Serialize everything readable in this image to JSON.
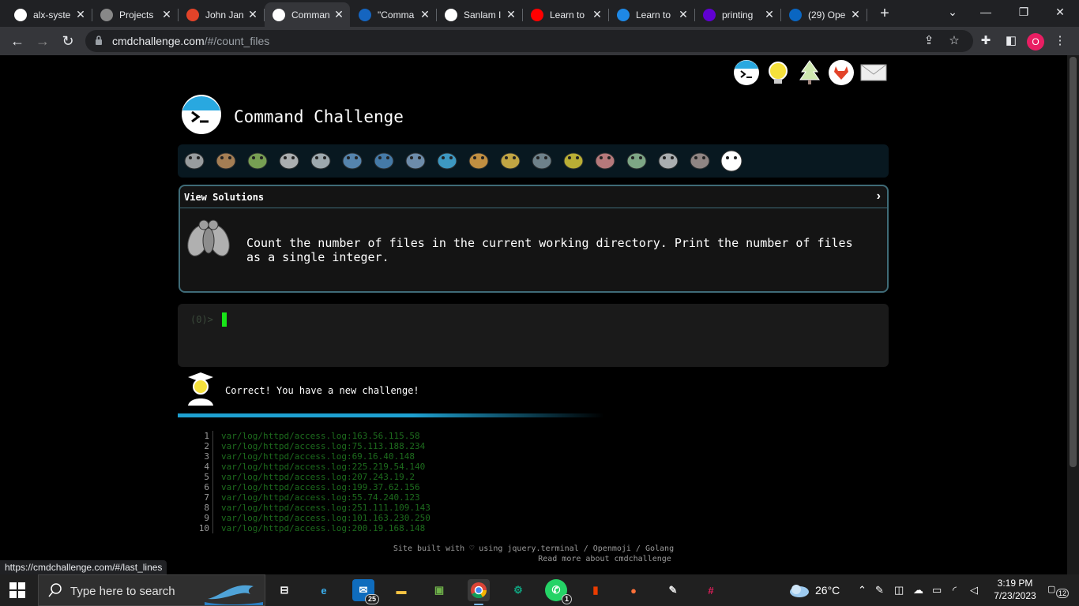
{
  "browser": {
    "tabs": [
      {
        "title": "alx-syste",
        "favicon": "github-icon",
        "color": "#ffffff"
      },
      {
        "title": "Projects",
        "favicon": "alx-icon",
        "color": "#888888"
      },
      {
        "title": "John Jan",
        "favicon": "gitlab-icon",
        "color": "#e24329"
      },
      {
        "title": "Comman",
        "favicon": "terminal-icon",
        "color": "#ffffff",
        "active": true
      },
      {
        "title": "\"Comma",
        "favicon": "warn-icon",
        "color": "#1565c0"
      },
      {
        "title": "Sanlam I",
        "favicon": "globe-icon",
        "color": "#ffffff"
      },
      {
        "title": "Learn to",
        "favicon": "youtube-icon",
        "color": "#ff0000"
      },
      {
        "title": "Learn to",
        "favicon": "globe-icon",
        "color": "#1e88e5"
      },
      {
        "title": "printing",
        "favicon": "yahoo-icon",
        "color": "#6001d2"
      },
      {
        "title": "(29) Ope",
        "favicon": "linkedin-icon",
        "color": "#0a66c2"
      }
    ],
    "new_tab": "+",
    "window": {
      "dropdown": "⌄",
      "minimize": "—",
      "maximize": "❐",
      "close": "✕"
    },
    "url": {
      "host": "cmdchallenge.com",
      "path": "/#/count_files"
    },
    "profile_initial": "O",
    "status_url": "https://cmdchallenge.com/#/last_lines"
  },
  "page": {
    "title": "Command Challenge",
    "panel_label": "View Solutions",
    "chevron": "›",
    "task": "Count the number of files in the current working directory. Print the number of files as a single integer.",
    "prompt": "(0)>",
    "success_message": "Correct! You have a new challenge!",
    "progress_fraction": 0.55,
    "output": [
      {
        "n": "1",
        "text": "var/log/httpd/access.log:163.56.115.58"
      },
      {
        "n": "2",
        "text": "var/log/httpd/access.log:75.113.188.234"
      },
      {
        "n": "3",
        "text": "var/log/httpd/access.log:69.16.40.148"
      },
      {
        "n": "4",
        "text": "var/log/httpd/access.log:225.219.54.140"
      },
      {
        "n": "5",
        "text": "var/log/httpd/access.log:207.243.19.2"
      },
      {
        "n": "6",
        "text": "var/log/httpd/access.log:199.37.62.156"
      },
      {
        "n": "7",
        "text": "var/log/httpd/access.log:55.74.240.123"
      },
      {
        "n": "8",
        "text": "var/log/httpd/access.log:251.111.109.143"
      },
      {
        "n": "9",
        "text": "var/log/httpd/access.log:101.163.230.250"
      },
      {
        "n": "10",
        "text": "var/log/httpd/access.log:200.19.168.148"
      }
    ],
    "footer_line1": "Site built with ♡ using jquery.terminal / Openmoji / Golang",
    "footer_line2": "Read more about cmdchallenge",
    "animals": [
      "snail-icon",
      "butterfly-icon",
      "caterpillar-icon",
      "ant-icon",
      "microbe-icon",
      "whale-icon",
      "dolphin-icon",
      "shark-icon",
      "fish-icon",
      "tropical-fish-icon",
      "blowfish-icon",
      "wolf-icon",
      "bee-icon",
      "ladybug-icon",
      "cricket-icon",
      "spider-icon",
      "scorpion-icon",
      "fly-icon"
    ]
  },
  "taskbar": {
    "search_placeholder": "Type here to search",
    "mail_badge": "25",
    "whatsapp_badge": "1",
    "weather": "26°C",
    "time": "3:19 PM",
    "date": "7/23/2023",
    "notifications": "12"
  },
  "colors": {
    "accent": "#1ea0d0",
    "cursor": "#18e518",
    "output_text": "#1d6b1d",
    "panel_border": "#3f6b77"
  }
}
